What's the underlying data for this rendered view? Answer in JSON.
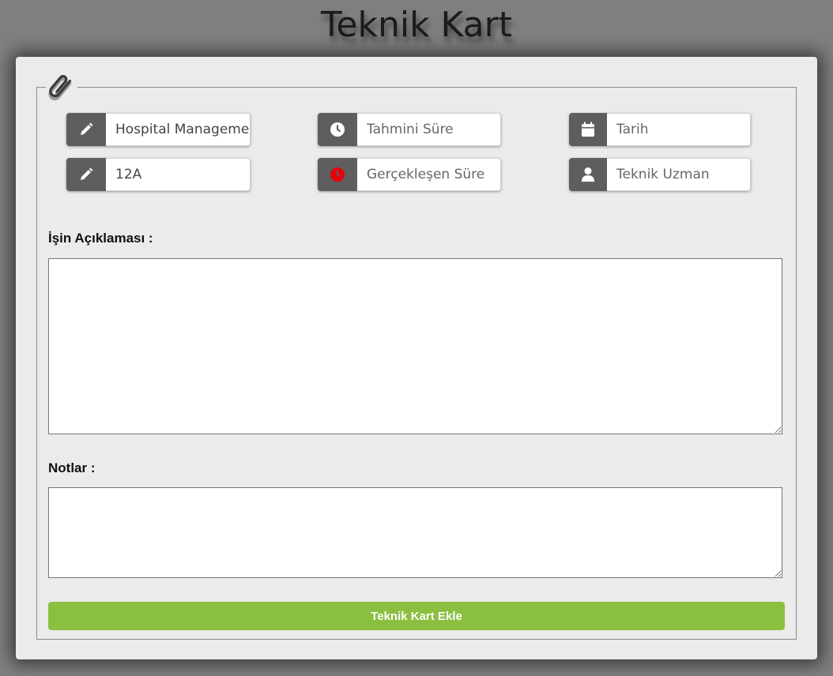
{
  "page": {
    "title": "Teknik Kart"
  },
  "form": {
    "fields": [
      {
        "name": "project",
        "icon": "pencil-icon",
        "value": "Hospital Management",
        "placeholder": ""
      },
      {
        "name": "estimated-time",
        "icon": "clock-icon",
        "value": "",
        "placeholder": "Tahmini Süre"
      },
      {
        "name": "date",
        "icon": "calendar-icon",
        "value": "",
        "placeholder": "Tarih"
      },
      {
        "name": "code",
        "icon": "pencil-icon",
        "value": "12A",
        "placeholder": ""
      },
      {
        "name": "actual-time",
        "icon": "clock-red-icon",
        "value": "",
        "placeholder": "Gerçekleşen Süre"
      },
      {
        "name": "technical-expert",
        "icon": "user-icon",
        "value": "",
        "placeholder": "Teknik Uzman"
      }
    ],
    "description_label": "İşin Açıklaması :",
    "notes_label": "Notlar :",
    "submit_label": "Teknik Kart Ekle"
  },
  "colors": {
    "background": "#7f7f7f",
    "card": "#ebebeb",
    "icon_addon": "#5e5e5e",
    "submit": "#8bbf3f",
    "alert_icon": "#e8000b"
  }
}
